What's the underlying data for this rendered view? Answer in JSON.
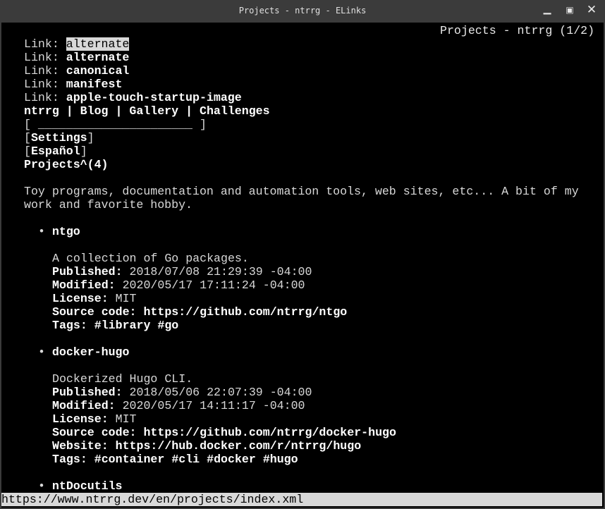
{
  "window": {
    "title": "Projects - ntrrg - ELinks",
    "controls": {
      "minimize": "minimize-icon",
      "maximize": "maximize-icon",
      "close": "close-icon"
    }
  },
  "page_status": "Projects - ntrrg (1/2)",
  "head_links": [
    {
      "label": "Link:",
      "value": "alternate",
      "selected": true
    },
    {
      "label": "Link:",
      "value": "alternate",
      "selected": false
    },
    {
      "label": "Link:",
      "value": "canonical",
      "selected": false
    },
    {
      "label": "Link:",
      "value": "manifest",
      "selected": false
    },
    {
      "label": "Link:",
      "value": "apple-touch-startup-image",
      "selected": false
    }
  ],
  "nav": {
    "items": [
      "ntrrg",
      "Blog",
      "Gallery",
      "Challenges"
    ],
    "separator": " | "
  },
  "search": {
    "open": "[ ",
    "field": "______________________",
    "close": " ]"
  },
  "settings_button": "Settings",
  "language_button": "Español",
  "heading": "Projects^(4)",
  "intro": [
    "Toy programs, documentation and automation tools, web sites, etc... A bit of my",
    "work and favorite hobby."
  ],
  "bullet": "•",
  "projects": [
    {
      "name": "ntgo",
      "description": "A collection of Go packages.",
      "fields": [
        {
          "label": "Published:",
          "value": "2018/07/08 21:29:39 -04:00",
          "link": false
        },
        {
          "label": "Modified:",
          "value": "2020/05/17 17:11:24 -04:00",
          "link": false
        },
        {
          "label": "License:",
          "value": "MIT",
          "link": false
        },
        {
          "label": "Source code:",
          "value": "https://github.com/ntrrg/ntgo",
          "link": true
        }
      ],
      "tags_label": "Tags:",
      "tags": [
        "#library",
        "#go"
      ]
    },
    {
      "name": "docker-hugo",
      "description": "Dockerized Hugo CLI.",
      "fields": [
        {
          "label": "Published:",
          "value": "2018/05/06 22:07:39 -04:00",
          "link": false
        },
        {
          "label": "Modified:",
          "value": "2020/05/17 14:11:17 -04:00",
          "link": false
        },
        {
          "label": "License:",
          "value": "MIT",
          "link": false
        },
        {
          "label": "Source code:",
          "value": "https://github.com/ntrrg/docker-hugo",
          "link": true
        },
        {
          "label": "Website:",
          "value": "https://hub.docker.com/r/ntrrg/hugo",
          "link": true
        }
      ],
      "tags_label": "Tags:",
      "tags": [
        "#container",
        "#cli",
        "#docker",
        "#hugo"
      ]
    },
    {
      "name": "ntDocutils",
      "description": "",
      "fields": [],
      "tags_label": "",
      "tags": []
    }
  ],
  "status_url": "https://www.ntrrg.dev/en/projects/index.xml"
}
